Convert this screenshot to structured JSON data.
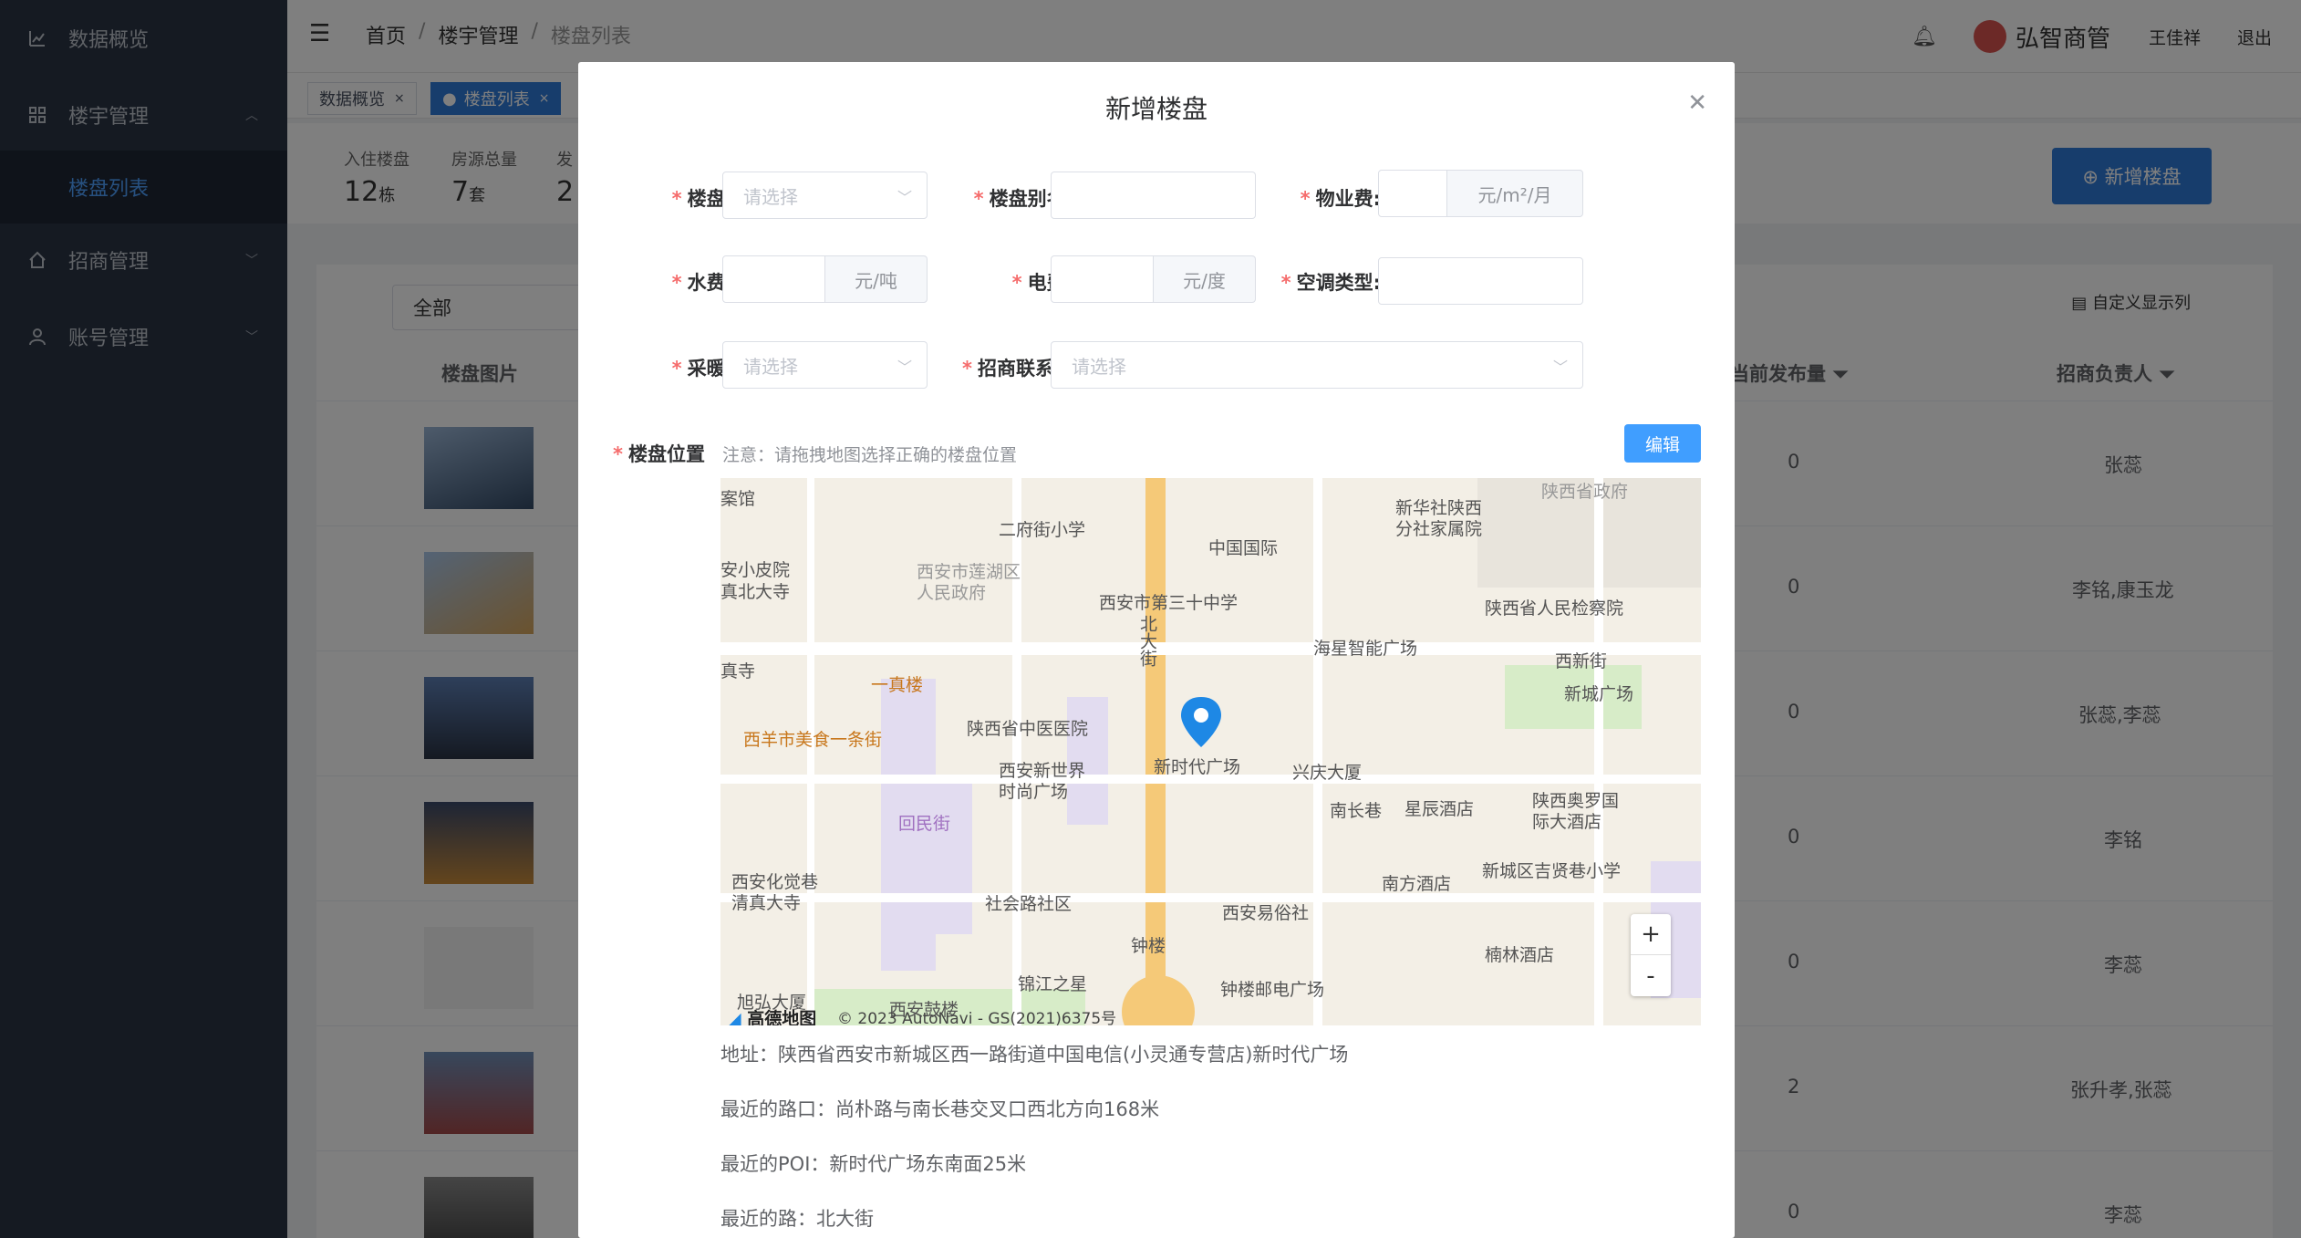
{
  "sidebar": {
    "items": [
      {
        "label": "数据概览",
        "icon": "chart-icon"
      },
      {
        "label": "楼宇管理",
        "icon": "building-icon"
      },
      {
        "label": "楼盘列表"
      },
      {
        "label": "招商管理",
        "icon": "home-icon"
      },
      {
        "label": "账号管理",
        "icon": "user-icon"
      }
    ]
  },
  "header": {
    "breadcrumb": [
      "首页",
      "楼宇管理",
      "楼盘列表"
    ],
    "brand": "弘智商管",
    "user": "王佳祥",
    "logout": "退出"
  },
  "tabs": [
    {
      "label": "数据概览"
    },
    {
      "label": "楼盘列表"
    }
  ],
  "stats": [
    {
      "label": "入住楼盘",
      "value": "12",
      "unit": "栋"
    },
    {
      "label": "房源总量",
      "value": "7",
      "unit": "套"
    },
    {
      "label": "发",
      "value": "2",
      "unit": ""
    }
  ],
  "toolbar": {
    "add_button": "⊕ 新增楼盘",
    "filter_value": "全部",
    "custom_columns": "自定义显示列"
  },
  "table": {
    "headers": [
      "楼盘图片",
      "当前发布量",
      "招商负责人"
    ],
    "rows": [
      {
        "published": "0",
        "owner": "张蕊"
      },
      {
        "published": "0",
        "owner": "李铭,康玉龙"
      },
      {
        "published": "0",
        "owner": "张蕊,李蕊"
      },
      {
        "published": "0",
        "owner": "李铭"
      },
      {
        "published": "0",
        "owner": "李蕊"
      },
      {
        "published": "2",
        "owner": "张升孝,张蕊"
      },
      {
        "published": "0",
        "owner": "李蕊"
      }
    ]
  },
  "dialog": {
    "title": "新增楼盘",
    "fields": {
      "building": {
        "label": "楼盘:",
        "placeholder": "请选择"
      },
      "alias": {
        "label": "楼盘别名:"
      },
      "property_fee": {
        "label": "物业费:",
        "unit": "元/m²/月"
      },
      "water": {
        "label": "水费:",
        "unit": "元/吨"
      },
      "electric": {
        "label": "电费:",
        "unit": "元/度"
      },
      "ac_type": {
        "label": "空调类型:"
      },
      "heating": {
        "label": "采暖:",
        "placeholder": "请选择"
      },
      "contact": {
        "label": "招商联系人",
        "placeholder": "请选择"
      },
      "location": {
        "label": "楼盘位置",
        "note": "注意：请拖拽地图选择正确的楼盘位置"
      }
    },
    "edit_button": "编辑",
    "map": {
      "labels": [
        "案馆",
        "二府街小学",
        "新华社陕西分社家属院",
        "陕西省政府",
        "中国国际",
        "安小皮院",
        "真北大寺",
        "西安市莲湖区人民政府",
        "西安市第三十中学",
        "陕西省人民检察院",
        "海星智能广场",
        "真寺",
        "一真楼",
        "北大街",
        "西新街",
        "新城广场",
        "陕西省中医医院",
        "西羊市美食一条街",
        "新时代广场",
        "兴庆大厦",
        "西安新世界时尚广场",
        "南长巷",
        "星辰酒店",
        "陕西奥罗国际大酒店",
        "回民街",
        "西安化觉巷清真大寺",
        "南方酒店",
        "新城区吉贤巷小学",
        "社会路社区",
        "西安易俗社",
        "钟楼",
        "楠林酒店",
        "锦江之星",
        "钟楼邮电广场",
        "旭弘大厦",
        "西安鼓楼"
      ],
      "zoom_in": "+",
      "zoom_out": "-",
      "logo": "高德地图",
      "copyright": "© 2023 AutoNavi - GS(2021)6375号"
    },
    "address": "地址：陕西省西安市新城区西一路街道中国电信(小灵通专营店)新时代广场",
    "nearest_road_cross": "最近的路口：尚朴路与南长巷交叉口西北方向168米",
    "nearest_poi": "最近的POI：新时代广场东南面25米",
    "nearest_road": "最近的路：北大街"
  }
}
